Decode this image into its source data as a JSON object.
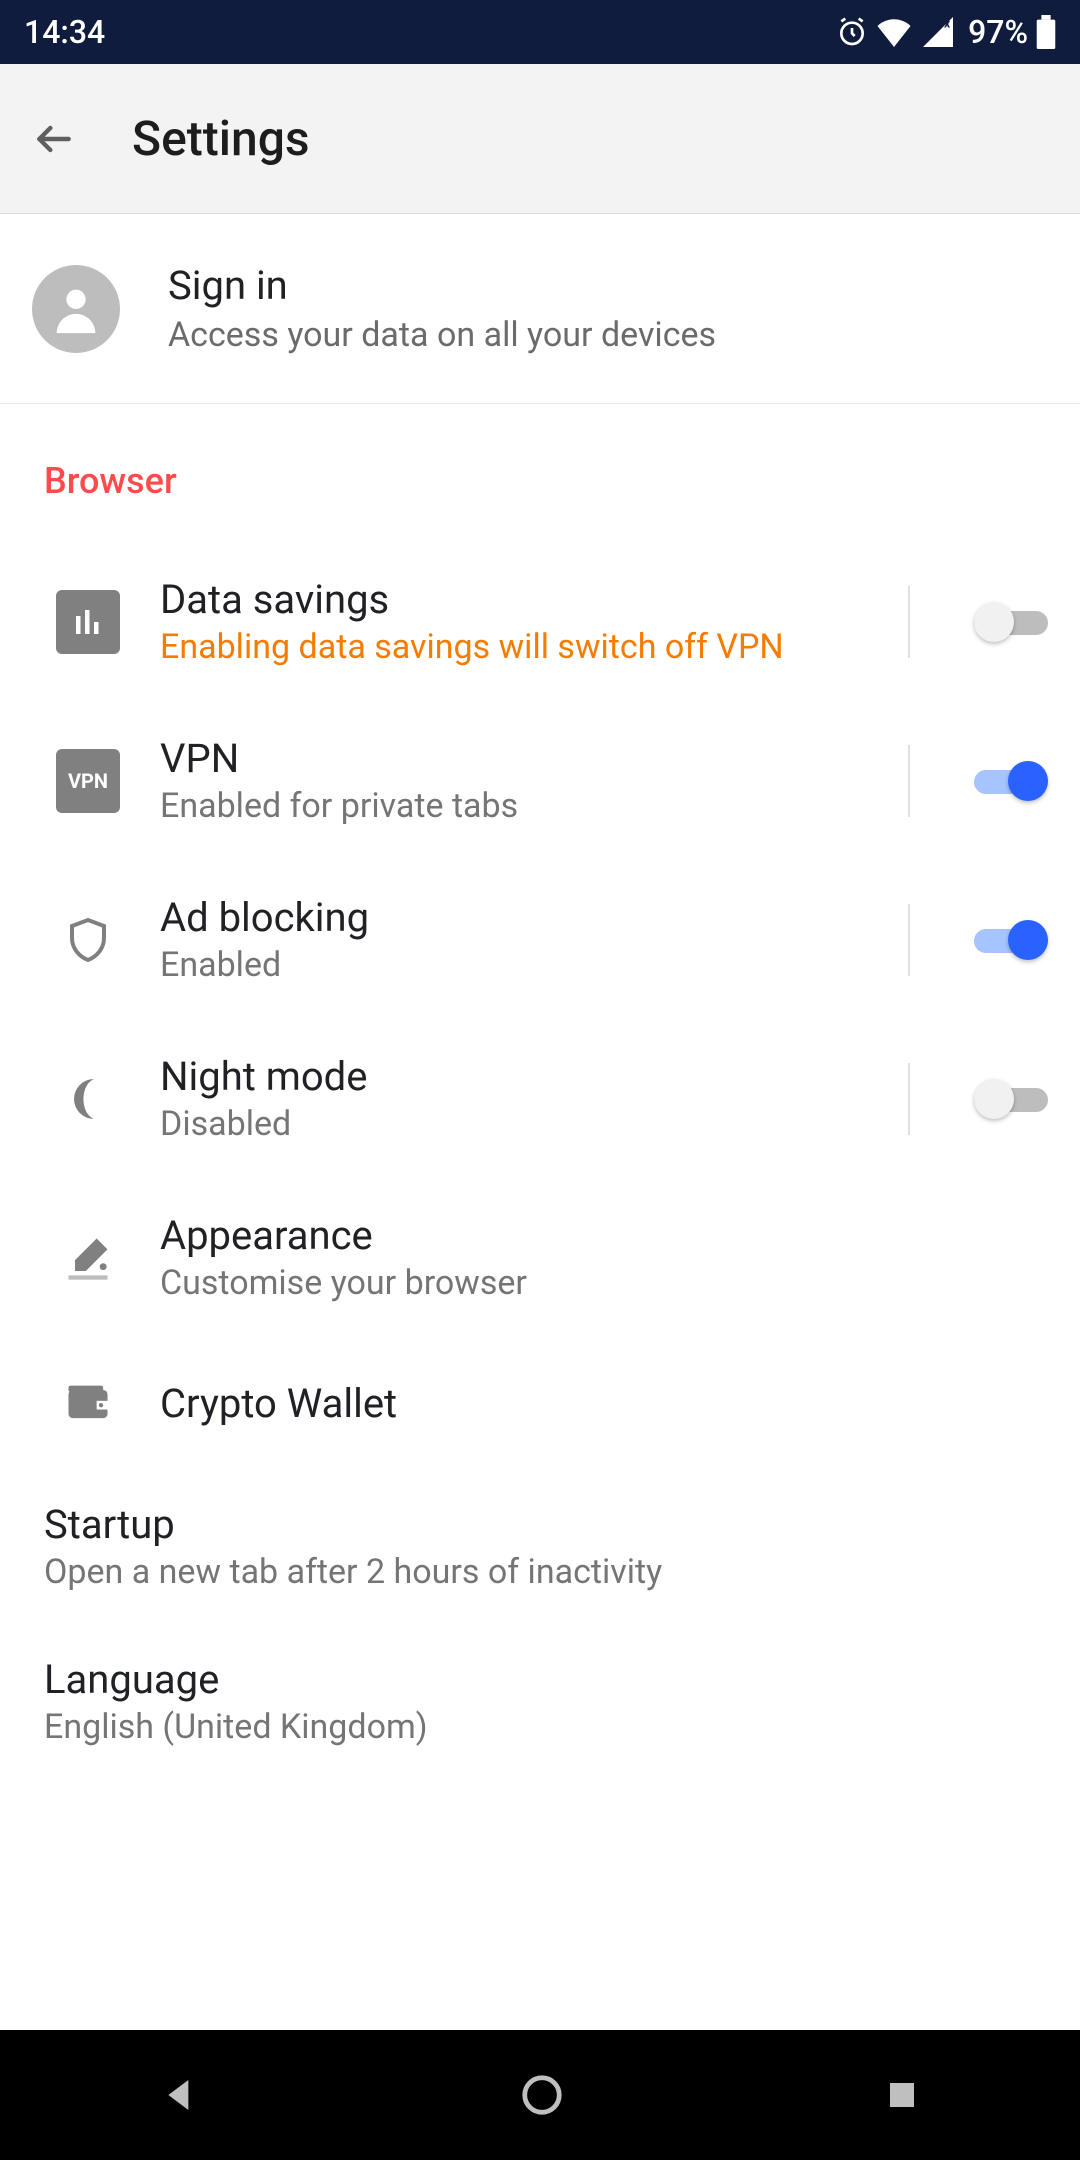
{
  "status": {
    "time": "14:34",
    "battery": "97%"
  },
  "appbar": {
    "title": "Settings"
  },
  "account": {
    "title": "Sign in",
    "sub": "Access your data on all your devices"
  },
  "section": {
    "browser": "Browser"
  },
  "rows": {
    "data_savings": {
      "title": "Data savings",
      "sub": "Enabling data savings will switch off VPN",
      "on": false
    },
    "vpn": {
      "title": "VPN",
      "sub": "Enabled for private tabs",
      "on": true,
      "icon_label": "VPN"
    },
    "adblock": {
      "title": "Ad blocking",
      "sub": "Enabled",
      "on": true
    },
    "nightmode": {
      "title": "Night mode",
      "sub": "Disabled",
      "on": false
    },
    "appearance": {
      "title": "Appearance",
      "sub": "Customise your browser"
    },
    "wallet": {
      "title": "Crypto Wallet"
    },
    "startup": {
      "title": "Startup",
      "sub": "Open a new tab after 2 hours of inactivity"
    },
    "language": {
      "title": "Language",
      "sub": "English (United Kingdom)"
    }
  }
}
